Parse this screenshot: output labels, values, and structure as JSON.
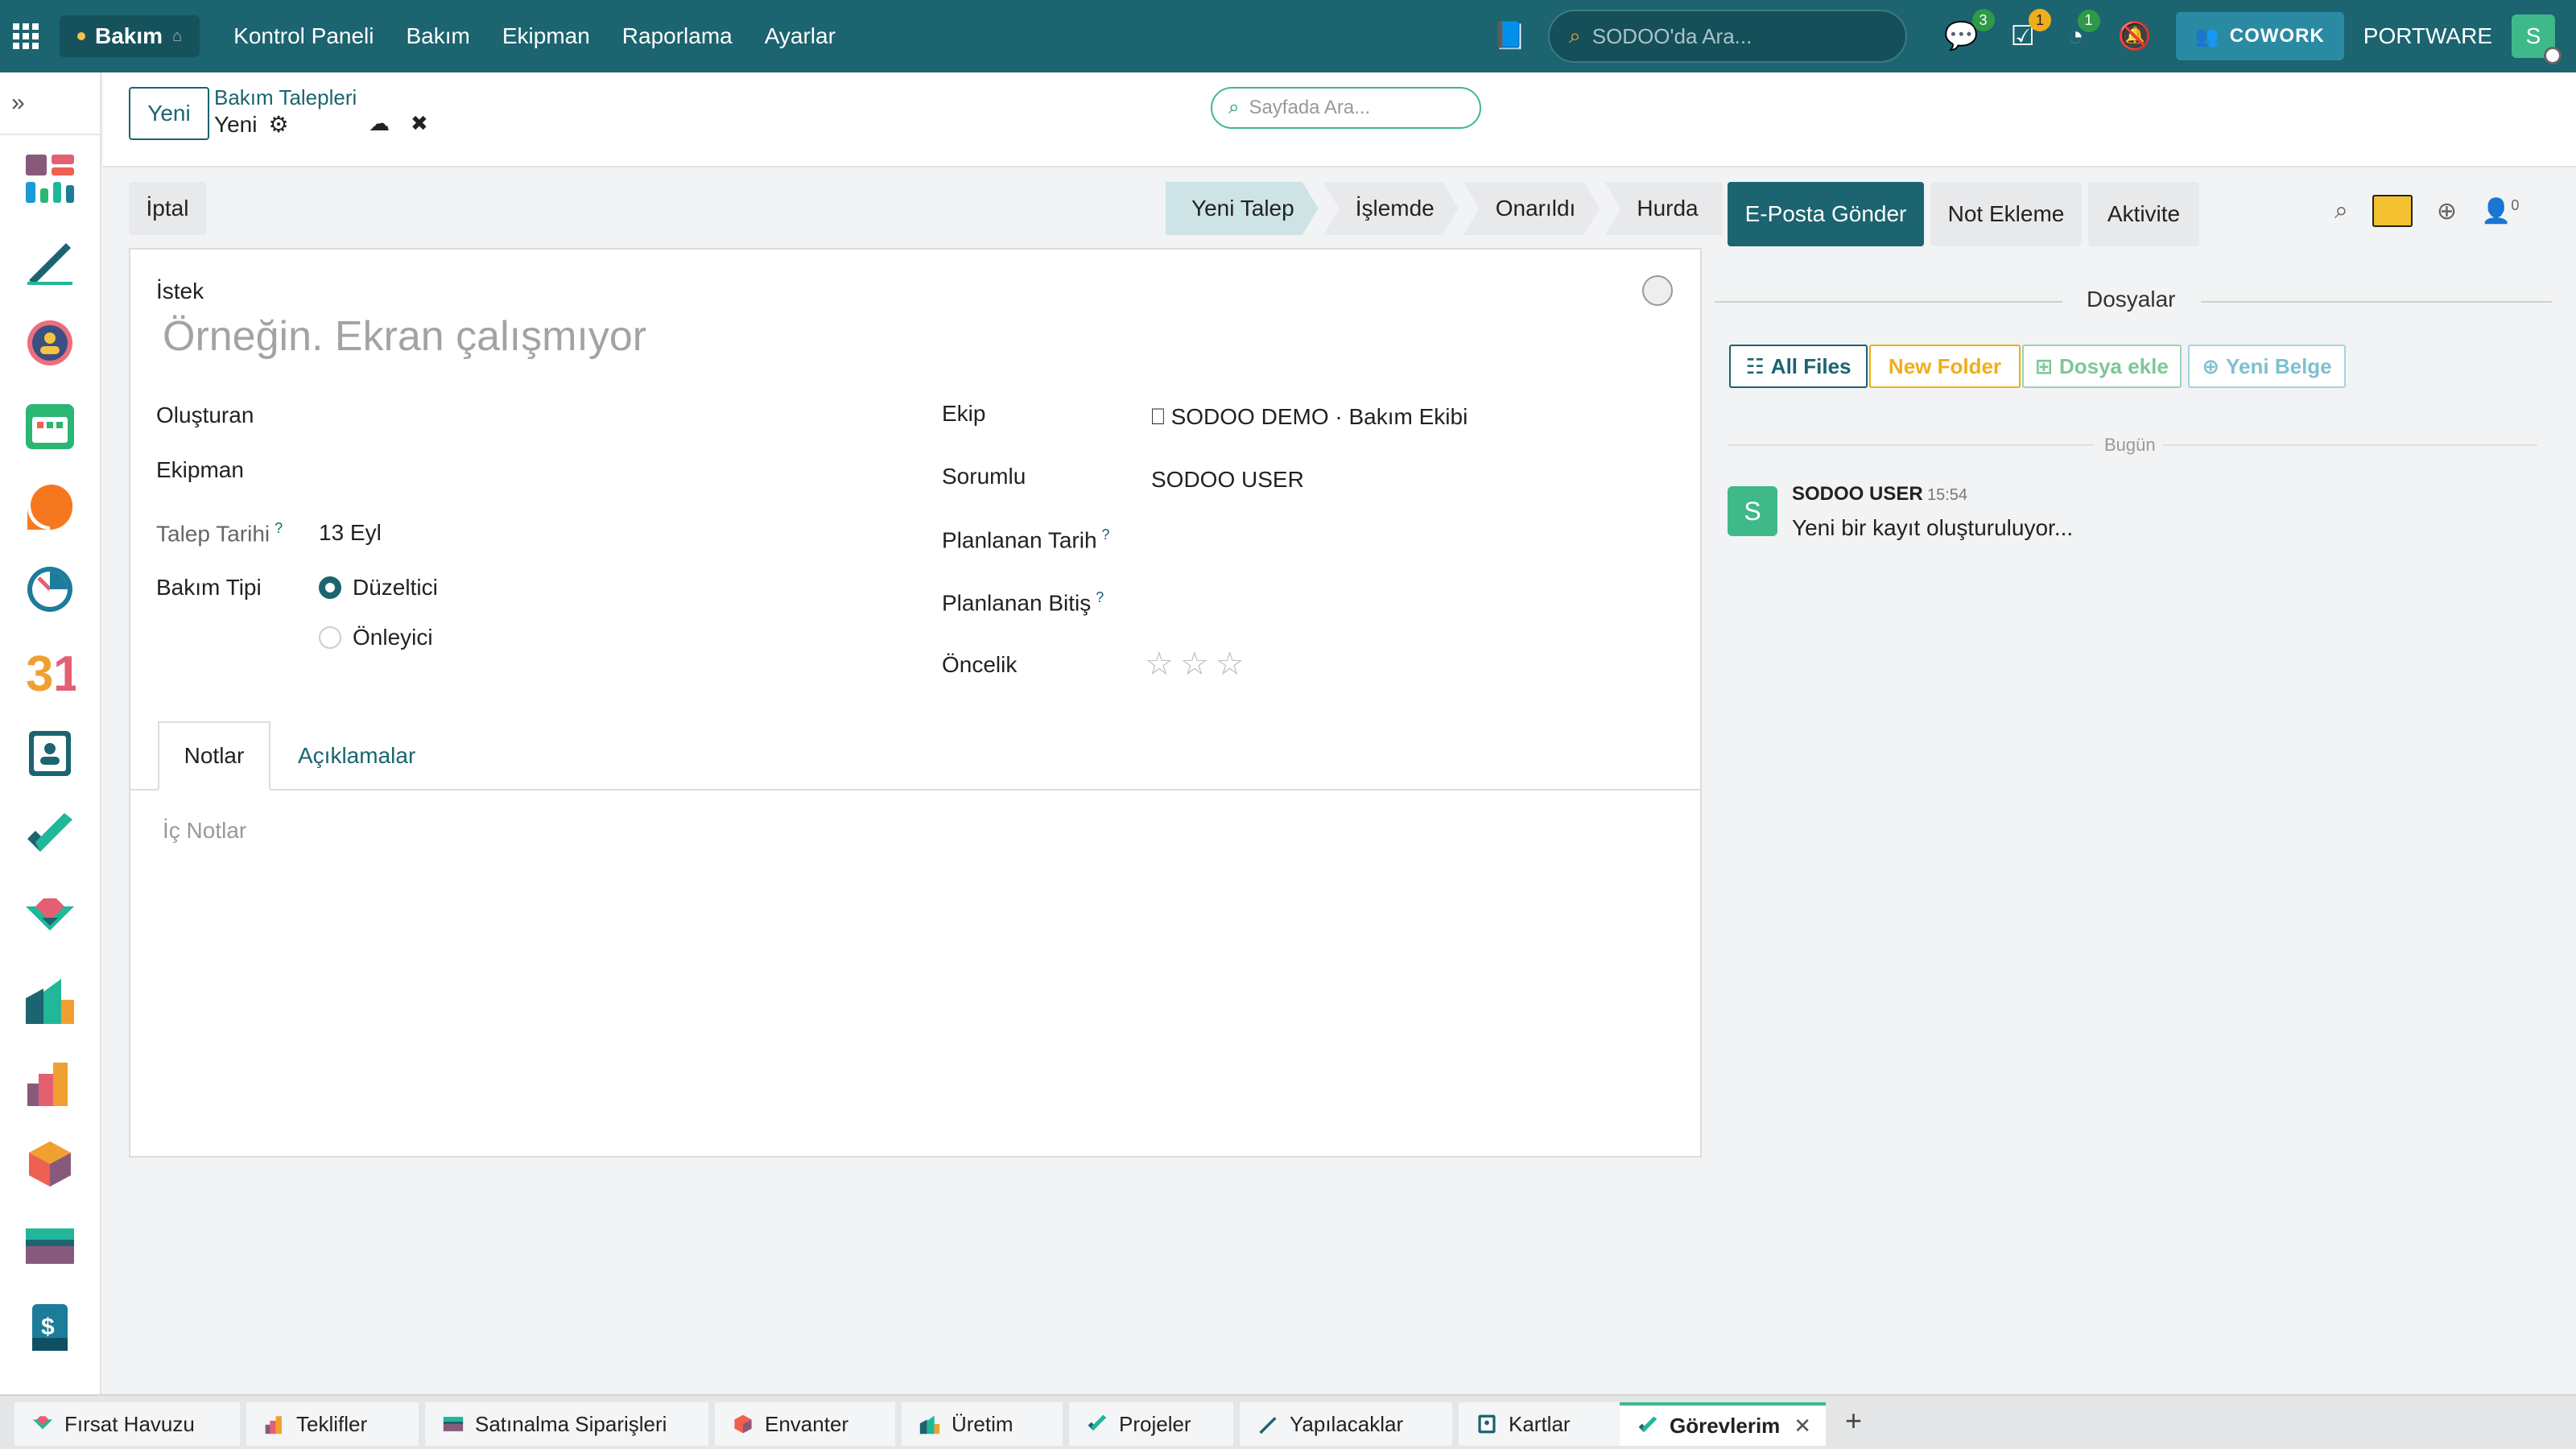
{
  "topbar": {
    "app_name": "Bakım",
    "menu": [
      "Kontrol Paneli",
      "Bakım",
      "Ekipman",
      "Raporlama",
      "Ayarlar"
    ],
    "search_placeholder": "SODOO'da Ara...",
    "badges": {
      "messages": "3",
      "activities": "1",
      "timer": "1"
    },
    "cowork_label": "COWORK",
    "company": "PORTWARE",
    "user_initial": "S",
    "accent_color": "#1b6470"
  },
  "control": {
    "new_button": "Yeni",
    "breadcrumb_parent": "Bakım Talepleri",
    "breadcrumb_current": "Yeni",
    "page_search_placeholder": "Sayfada Ara..."
  },
  "statusbar": {
    "cancel_button": "İptal",
    "stages": [
      "Yeni Talep",
      "İşlemde",
      "Onarıldı",
      "Hurda"
    ],
    "active_stage": "Yeni Talep"
  },
  "form": {
    "request_label": "İstek",
    "request_placeholder": "Örneğin. Ekran çalışmıyor",
    "created_by_label": "Oluşturan",
    "equipment_label": "Ekipman",
    "request_date_label": "Talep Tarihi",
    "request_date_value": "13 Eyl",
    "maintenance_type_label": "Bakım Tipi",
    "maintenance_type_options": [
      "Düzeltici",
      "Önleyici"
    ],
    "maintenance_type_selected": "Düzeltici",
    "team_label": "Ekip",
    "team_value": "⎕ SODOO DEMO · Bakım Ekibi",
    "responsible_label": "Sorumlu",
    "responsible_value": "SODOO USER",
    "planned_date_label": "Planlanan Tarih",
    "planned_end_label": "Planlanan Bitiş",
    "priority_label": "Öncelik",
    "priority_value": 0,
    "priority_max": 3,
    "help_mark": "?",
    "tabs": [
      "Notlar",
      "Açıklamalar"
    ],
    "notes_placeholder": "İç Notlar"
  },
  "chatter": {
    "send_email": "E-Posta Gönder",
    "log_note": "Not Ekleme",
    "activity": "Aktivite",
    "followers_count": "0",
    "files_header": "Dosyalar",
    "file_buttons": [
      "All Files",
      "New Folder",
      "Dosya ekle",
      "Yeni Belge"
    ],
    "date_separator": "Bugün",
    "message": {
      "author_initial": "S",
      "author": "SODOO USER",
      "time": "15:54",
      "body": "Yeni bir kayıt oluşturuluyor..."
    }
  },
  "bottom_tabs": [
    "Fırsat Havuzu",
    "Teklifler",
    "Satınalma Siparişleri",
    "Envanter",
    "Üretim",
    "Projeler",
    "Yapılacaklar",
    "Kartlar",
    "Görevlerim"
  ],
  "active_bottom_tab": "Görevlerim"
}
